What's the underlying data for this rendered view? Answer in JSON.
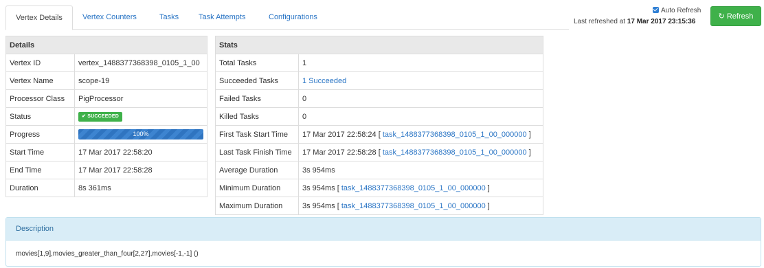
{
  "tabs": [
    {
      "label": "Vertex Details",
      "active": true
    },
    {
      "label": "Vertex Counters"
    },
    {
      "label": "Tasks"
    },
    {
      "label": "Task Attempts"
    },
    {
      "label": "Configurations"
    }
  ],
  "refresh": {
    "auto_refresh_label": "Auto Refresh",
    "auto_refresh_checked": true,
    "last_refreshed_prefix": "Last refreshed at",
    "last_refreshed_time": "17 Mar 2017 23:15:36",
    "button_label": "Refresh",
    "button_icon": "refresh-icon"
  },
  "details": {
    "header": "Details",
    "rows": {
      "vertex_id": {
        "label": "Vertex ID",
        "value": "vertex_1488377368398_0105_1_00"
      },
      "vertex_name": {
        "label": "Vertex Name",
        "value": "scope-19"
      },
      "processor_class": {
        "label": "Processor Class",
        "value": "PigProcessor"
      },
      "status": {
        "label": "Status",
        "value": "✔ SUCCEEDED",
        "color": "#3fb14a"
      },
      "progress": {
        "label": "Progress",
        "value": "100%",
        "fraction": 1.0
      },
      "start_time": {
        "label": "Start Time",
        "value": "17 Mar 2017 22:58:20"
      },
      "end_time": {
        "label": "End Time",
        "value": "17 Mar 2017 22:58:28"
      },
      "duration": {
        "label": "Duration",
        "value": "8s 361ms"
      }
    }
  },
  "stats": {
    "header": "Stats",
    "rows": {
      "total_tasks": {
        "label": "Total Tasks",
        "value": "1"
      },
      "succeeded_tasks": {
        "label": "Succeeded Tasks",
        "value": "1 Succeeded"
      },
      "failed_tasks": {
        "label": "Failed Tasks",
        "value": "0"
      },
      "killed_tasks": {
        "label": "Killed Tasks",
        "value": "0"
      },
      "first_task_start": {
        "label": "First Task Start Time",
        "value": "17 Mar 2017 22:58:24",
        "task": "task_1488377368398_0105_1_00_000000"
      },
      "last_task_finish": {
        "label": "Last Task Finish Time",
        "value": "17 Mar 2017 22:58:28",
        "task": "task_1488377368398_0105_1_00_000000"
      },
      "average_duration": {
        "label": "Average Duration",
        "value": "3s 954ms"
      },
      "minimum_duration": {
        "label": "Minimum Duration",
        "value": "3s 954ms",
        "task": "task_1488377368398_0105_1_00_000000"
      },
      "maximum_duration": {
        "label": "Maximum Duration",
        "value": "3s 954ms",
        "task": "task_1488377368398_0105_1_00_000000"
      }
    }
  },
  "description": {
    "header": "Description",
    "text": "movies[1,9],movies_greater_than_four[2,27],movies[-1,-1] ()"
  },
  "colors": {
    "accent": "#2a75c5",
    "success": "#3fb14a",
    "progress": "#2f74c0",
    "panel_header": "#d9edf7"
  }
}
